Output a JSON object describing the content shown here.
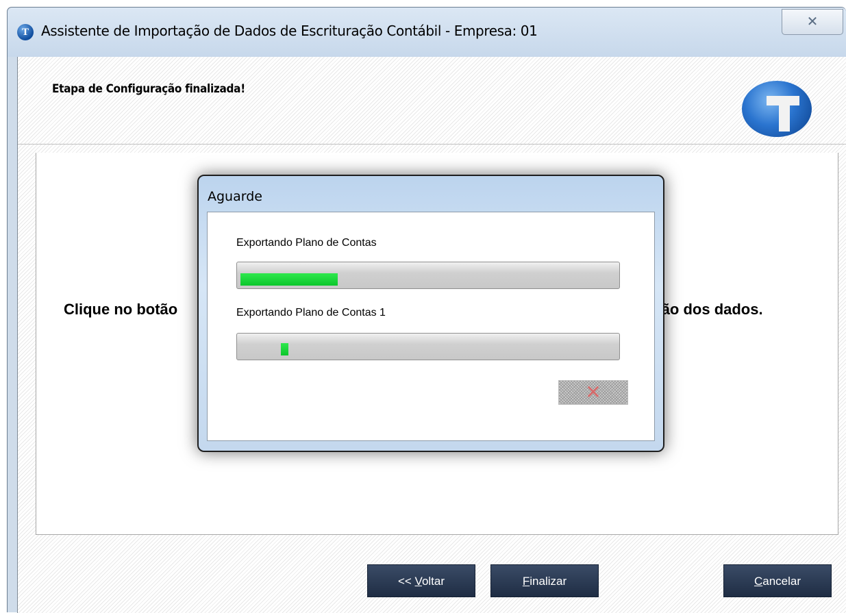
{
  "window": {
    "title": "Assistente de Importação de Dados de Escrituração Contábil - Empresa: 01",
    "close_glyph": "✕"
  },
  "header": {
    "title": "Etapa de Configuração finalizada!",
    "logo_glyph": "T"
  },
  "content": {
    "instruction_left": "Clique no botão",
    "instruction_right": "ção dos dados."
  },
  "footer": {
    "back_button": {
      "prefix": "<< ",
      "mnemonic": "V",
      "rest": "oltar"
    },
    "finish_button": {
      "mnemonic": "F",
      "rest": "inalizar"
    },
    "cancel_button": {
      "mnemonic": "C",
      "rest": "ancelar"
    }
  },
  "dialog": {
    "title": "Aguarde",
    "progress": [
      {
        "label": "Exportando Plano de Contas",
        "fraction": 0.26
      },
      {
        "label": "Exportando Plano de Contas 1",
        "fraction": 0.02
      }
    ],
    "cancel_glyph": "✕"
  },
  "colors": {
    "progress_green": "#12d230",
    "button_bg": "#2a3a55"
  }
}
